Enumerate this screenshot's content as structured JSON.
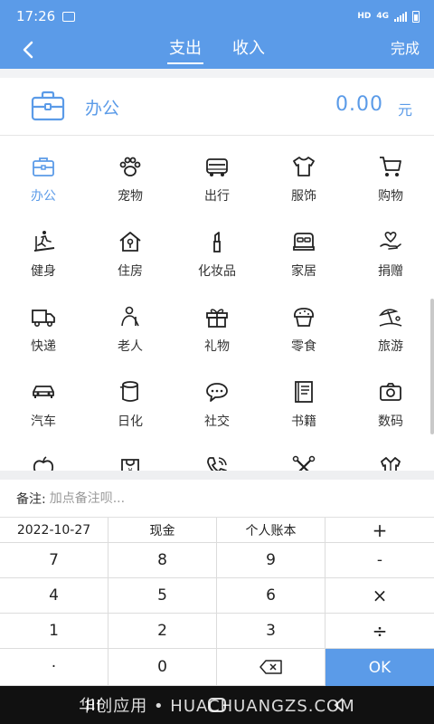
{
  "status_bar": {
    "time": "17:26",
    "network": "HD",
    "net_type": "4G"
  },
  "nav": {
    "tabs": [
      {
        "label": "支出"
      },
      {
        "label": "收入"
      }
    ],
    "done": "完成"
  },
  "selected": {
    "label": "办公",
    "amount": "0.00",
    "unit": "元"
  },
  "categories": [
    {
      "label": "办公",
      "icon": "briefcase-icon"
    },
    {
      "label": "宠物",
      "icon": "paw-icon"
    },
    {
      "label": "出行",
      "icon": "car-icon"
    },
    {
      "label": "服饰",
      "icon": "shirt-icon"
    },
    {
      "label": "购物",
      "icon": "cart-icon"
    },
    {
      "label": "健身",
      "icon": "treadmill-icon"
    },
    {
      "label": "住房",
      "icon": "house-icon"
    },
    {
      "label": "化妆品",
      "icon": "lipstick-icon"
    },
    {
      "label": "家居",
      "icon": "bed-icon"
    },
    {
      "label": "捐赠",
      "icon": "heart-hand-icon"
    },
    {
      "label": "快递",
      "icon": "truck-icon"
    },
    {
      "label": "老人",
      "icon": "elder-icon"
    },
    {
      "label": "礼物",
      "icon": "gift-icon"
    },
    {
      "label": "零食",
      "icon": "muffin-icon"
    },
    {
      "label": "旅游",
      "icon": "beach-icon"
    },
    {
      "label": "汽车",
      "icon": "auto-icon"
    },
    {
      "label": "日化",
      "icon": "tissue-icon"
    },
    {
      "label": "社交",
      "icon": "chat-icon"
    },
    {
      "label": "书籍",
      "icon": "book-icon"
    },
    {
      "label": "数码",
      "icon": "camera-icon"
    },
    {
      "label": "",
      "icon": "apple-icon"
    },
    {
      "label": "",
      "icon": "bag-icon"
    },
    {
      "label": "",
      "icon": "phone-icon"
    },
    {
      "label": "",
      "icon": "tools-icon"
    },
    {
      "label": "",
      "icon": "clothes-icon"
    }
  ],
  "note": {
    "label": "备注:",
    "placeholder": "加点备注呗..."
  },
  "keypad": {
    "date": "2022-10-27",
    "account": "现金",
    "book": "个人账本",
    "plus": "+",
    "minus": "-",
    "times": "×",
    "divide": "÷",
    "dot": "·",
    "ok": "OK",
    "digits": [
      "7",
      "8",
      "9",
      "4",
      "5",
      "6",
      "1",
      "2",
      "3",
      "0"
    ]
  },
  "watermark": "华创应用 • HUACHUANGZS.COM",
  "colors": {
    "accent": "#5b9be8",
    "background": "#ffffff",
    "divider": "#dcdcdc"
  }
}
